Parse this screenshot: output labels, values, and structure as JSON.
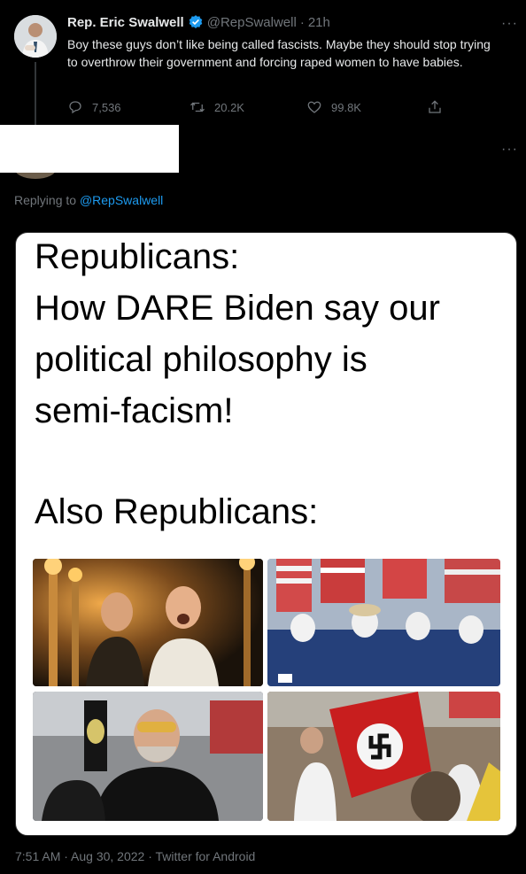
{
  "tweet": {
    "author_name": "Rep. Eric Swalwell",
    "handle": "@RepSwalwell",
    "separator": "·",
    "age": "21h",
    "text": "Boy these guys don’t like being called fascists. Maybe they should stop trying to overthrow their government and forcing raped women to have babies.",
    "replies": "7,536",
    "retweets": "20.2K",
    "likes": "99.8K",
    "more_label": "···"
  },
  "reply": {
    "more_label": "···",
    "replying_prefix": "Replying to",
    "replying_handle": "@RepSwalwell"
  },
  "meme": {
    "line1": "Republicans:",
    "line2": "How DARE Biden say our",
    "line3": "political philosophy is",
    "line4": "semi-facism!",
    "line5": "Also Republicans:"
  },
  "footer": {
    "text": "7:51 AM · Aug 30, 2022 · Twitter for Android"
  },
  "colors": {
    "background": "#000000",
    "link": "#1d9bf0",
    "muted": "#71767b",
    "verified": "#1d9bf0"
  }
}
